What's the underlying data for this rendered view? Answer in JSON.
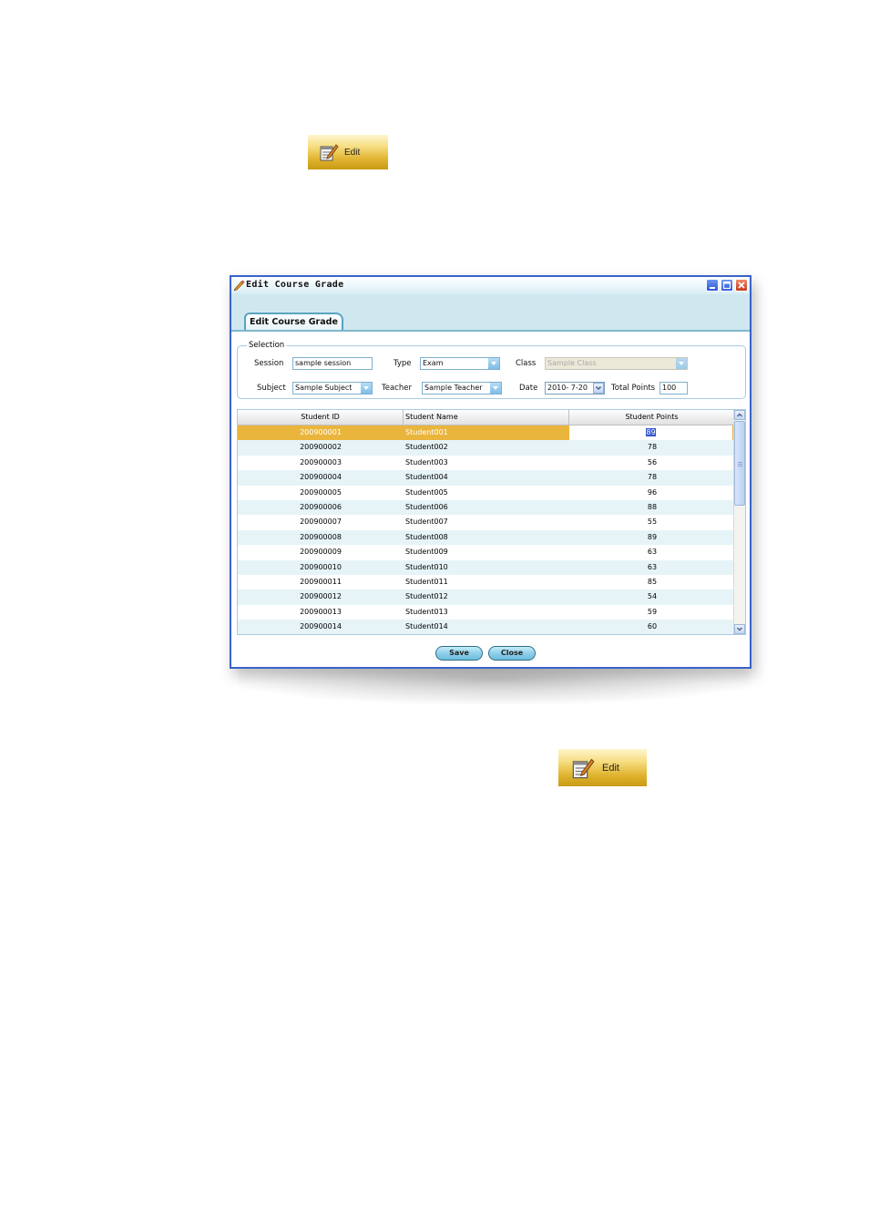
{
  "edit_button_top": {
    "label": "Edit",
    "icon": "notepad-pencil-icon"
  },
  "edit_button_bottom": {
    "label": "Edit",
    "icon": "notepad-pencil-icon"
  },
  "window": {
    "title": "Edit Course Grade",
    "title_icon": "pencil-icon",
    "controls": [
      "minimize-icon",
      "maximize-icon",
      "close-icon"
    ],
    "border_color": "#3a63c8"
  },
  "tab": {
    "label": "Edit Course Grade"
  },
  "selection": {
    "legend": "Selection",
    "session_label": "Session",
    "session_value": "sample session",
    "type_label": "Type",
    "type_value": "Exam",
    "class_label": "Class",
    "class_value": "Sample Class",
    "subject_label": "Subject",
    "subject_value": "Sample Subject",
    "teacher_label": "Teacher",
    "teacher_value": "Sample Teacher",
    "date_label": "Date",
    "date_value": "2010- 7-20",
    "total_points_label": "Total Points",
    "total_points_value": "100"
  },
  "grid": {
    "columns": [
      "Student ID",
      "Student Name",
      "Student Points"
    ],
    "selected_row_color": "#eab53c",
    "alt_row_color": "#e6f4f8",
    "rows": [
      {
        "id": "200900001",
        "name": "Student001",
        "points": "89"
      },
      {
        "id": "200900002",
        "name": "Student002",
        "points": "78"
      },
      {
        "id": "200900003",
        "name": "Student003",
        "points": "56"
      },
      {
        "id": "200900004",
        "name": "Student004",
        "points": "78"
      },
      {
        "id": "200900005",
        "name": "Student005",
        "points": "96"
      },
      {
        "id": "200900006",
        "name": "Student006",
        "points": "88"
      },
      {
        "id": "200900007",
        "name": "Student007",
        "points": "55"
      },
      {
        "id": "200900008",
        "name": "Student008",
        "points": "89"
      },
      {
        "id": "200900009",
        "name": "Student009",
        "points": "63"
      },
      {
        "id": "200900010",
        "name": "Student010",
        "points": "63"
      },
      {
        "id": "200900011",
        "name": "Student011",
        "points": "85"
      },
      {
        "id": "200900012",
        "name": "Student012",
        "points": "54"
      },
      {
        "id": "200900013",
        "name": "Student013",
        "points": "59"
      },
      {
        "id": "200900014",
        "name": "Student014",
        "points": "60"
      }
    ]
  },
  "buttons": {
    "save": "Save",
    "close": "Close"
  }
}
